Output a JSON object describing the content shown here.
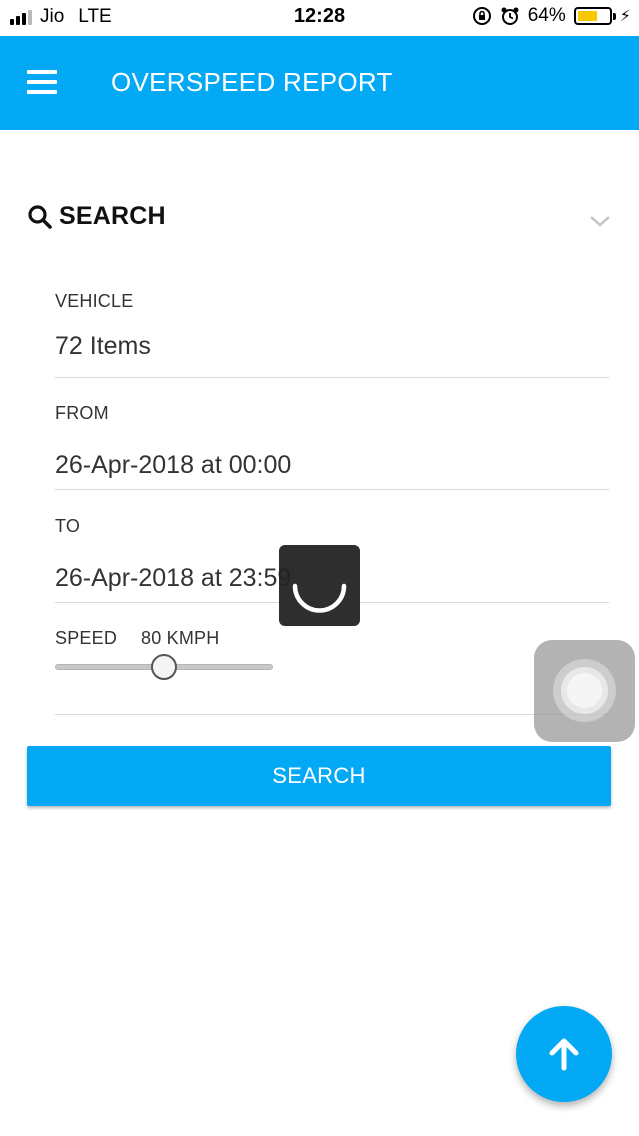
{
  "status_bar": {
    "carrier": "Jio",
    "network": "LTE",
    "time": "12:28",
    "battery_percent": "64%",
    "battery_level": 0.64
  },
  "header": {
    "title": "OVERSPEED REPORT",
    "menu_icon": "hamburger-icon",
    "bg_color": "#03a9f4"
  },
  "search_section": {
    "label": "SEARCH",
    "search_icon": "search-icon",
    "collapse_icon": "chevron-down-icon"
  },
  "form": {
    "vehicle": {
      "label": "VEHICLE",
      "value": "72 Items"
    },
    "from": {
      "label": "FROM",
      "value": "26-Apr-2018 at 00:00"
    },
    "to": {
      "label": "TO",
      "value": "26-Apr-2018 at 23:59"
    },
    "speed": {
      "label": "SPEED",
      "value_text": "80 KMPH",
      "slider_fraction": 0.5
    }
  },
  "search_button": {
    "label": "SEARCH"
  },
  "fab": {
    "icon": "arrow-up-icon"
  },
  "overlay": {
    "loading_icon": "loading-spinner-icon",
    "assistive_icon": "assistive-touch-icon"
  }
}
